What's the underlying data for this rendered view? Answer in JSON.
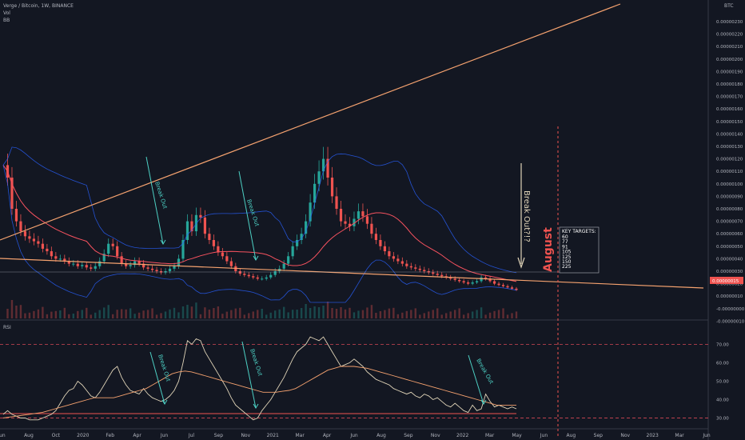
{
  "legend": {
    "symbol_line": "Verge / Bitcoin, 1W, BINANCE",
    "vol": "Vol",
    "bb": "BB",
    "rsi": "RSI"
  },
  "price_axis_currency": "BTC",
  "current_price_tag": "0.00000015",
  "chart_data": [
    {
      "type": "candlestick",
      "title": "Verge / Bitcoin, 1W, BINANCE",
      "ylabel": "BTC",
      "y_ticks": [
        "0.00000230",
        "0.00000220",
        "0.00000210",
        "0.00000200",
        "0.00000190",
        "0.00000180",
        "0.00000170",
        "0.00000160",
        "0.00000150",
        "0.00000140",
        "0.00000130",
        "0.00000120",
        "0.00000110",
        "0.00000100",
        "0.00000090",
        "0.00000080",
        "0.00000070",
        "0.00000060",
        "0.00000050",
        "0.00000040",
        "0.00000030",
        "0.00000020",
        "0.00000010",
        "-0.00000000",
        "-0.00000010"
      ],
      "x_ticks": [
        "Jun",
        "Aug",
        "Oct",
        "2020",
        "Feb",
        "Apr",
        "Jun",
        "Jul",
        "Sep",
        "Nov",
        "2021",
        "Mar",
        "Apr",
        "Jun",
        "Aug",
        "Sep",
        "Nov",
        "2022",
        "Mar",
        "May",
        "Jun",
        "Aug",
        "Sep",
        "Nov",
        "2023",
        "Mar",
        "Jun"
      ],
      "close_series": [
        1.15,
        1.05,
        0.8,
        0.7,
        0.62,
        0.58,
        0.56,
        0.54,
        0.52,
        0.48,
        0.46,
        0.42,
        0.4,
        0.4,
        0.38,
        0.36,
        0.36,
        0.34,
        0.35,
        0.33,
        0.32,
        0.34,
        0.38,
        0.44,
        0.52,
        0.5,
        0.42,
        0.36,
        0.34,
        0.35,
        0.38,
        0.36,
        0.33,
        0.32,
        0.31,
        0.3,
        0.29,
        0.3,
        0.32,
        0.34,
        0.4,
        0.55,
        0.7,
        0.62,
        0.75,
        0.73,
        0.6,
        0.55,
        0.5,
        0.45,
        0.42,
        0.38,
        0.34,
        0.3,
        0.28,
        0.27,
        0.26,
        0.25,
        0.24,
        0.24,
        0.25,
        0.27,
        0.3,
        0.32,
        0.36,
        0.42,
        0.5,
        0.55,
        0.6,
        0.7,
        0.85,
        1.0,
        1.1,
        1.2,
        1.05,
        0.9,
        0.8,
        0.7,
        0.68,
        0.66,
        0.72,
        0.78,
        0.74,
        0.68,
        0.6,
        0.55,
        0.5,
        0.46,
        0.42,
        0.4,
        0.38,
        0.36,
        0.34,
        0.33,
        0.32,
        0.31,
        0.3,
        0.29,
        0.28,
        0.27,
        0.26,
        0.25,
        0.24,
        0.23,
        0.22,
        0.21,
        0.2,
        0.21,
        0.22,
        0.25,
        0.24,
        0.22,
        0.2,
        0.19,
        0.18,
        0.17,
        0.16,
        0.15
      ],
      "annotations": [
        "Break Out",
        "Break Out",
        "Break Out?!?",
        "August"
      ],
      "key_targets": {
        "title": "KEY TARGETS:",
        "values": [
          "60",
          "77",
          "91",
          "105",
          "125",
          "150",
          "225"
        ]
      }
    },
    {
      "type": "line",
      "title": "RSI",
      "y_ticks": [
        "70.00",
        "60.00",
        "50.00",
        "40.00",
        "30.00"
      ],
      "ylim": [
        25,
        78
      ],
      "rsi_series": [
        32,
        34,
        32,
        31,
        30,
        30,
        29,
        29,
        29,
        30,
        31,
        32,
        34,
        38,
        42,
        45,
        46,
        50,
        48,
        45,
        42,
        41,
        44,
        48,
        52,
        56,
        58,
        52,
        48,
        45,
        44,
        43,
        46,
        43,
        41,
        40,
        39,
        40,
        42,
        45,
        50,
        60,
        72,
        70,
        73,
        72,
        66,
        62,
        58,
        54,
        50,
        46,
        41,
        37,
        35,
        33,
        31,
        29,
        30,
        34,
        37,
        40,
        44,
        48,
        52,
        57,
        62,
        66,
        68,
        70,
        74,
        73,
        72,
        74,
        70,
        66,
        62,
        58,
        59,
        60,
        62,
        60,
        58,
        55,
        53,
        51,
        50,
        49,
        48,
        46,
        45,
        44,
        43,
        44,
        42,
        41,
        43,
        42,
        40,
        41,
        39,
        37,
        36,
        38,
        36,
        34,
        33,
        37,
        34,
        35,
        43,
        39,
        36,
        37,
        36,
        35,
        36,
        35
      ],
      "rsi_ma_series": [
        30,
        30.5,
        31,
        31.5,
        32,
        32.5,
        33,
        34,
        35,
        36,
        37,
        38,
        39,
        40,
        41,
        41,
        41,
        41,
        42,
        43,
        44,
        45,
        46,
        48,
        50,
        52,
        54,
        55,
        55.5,
        55,
        54,
        53,
        52,
        51,
        50,
        49,
        48,
        47,
        46,
        45,
        44,
        44,
        44,
        44.5,
        45,
        46,
        48,
        50,
        52,
        54,
        56,
        57,
        58,
        58,
        58,
        57.5,
        57,
        56,
        55,
        54,
        53,
        52,
        51,
        50,
        49,
        48,
        47,
        46,
        45,
        44,
        43,
        42,
        41,
        40,
        39,
        38,
        37,
        37,
        37,
        37
      ]
    }
  ]
}
